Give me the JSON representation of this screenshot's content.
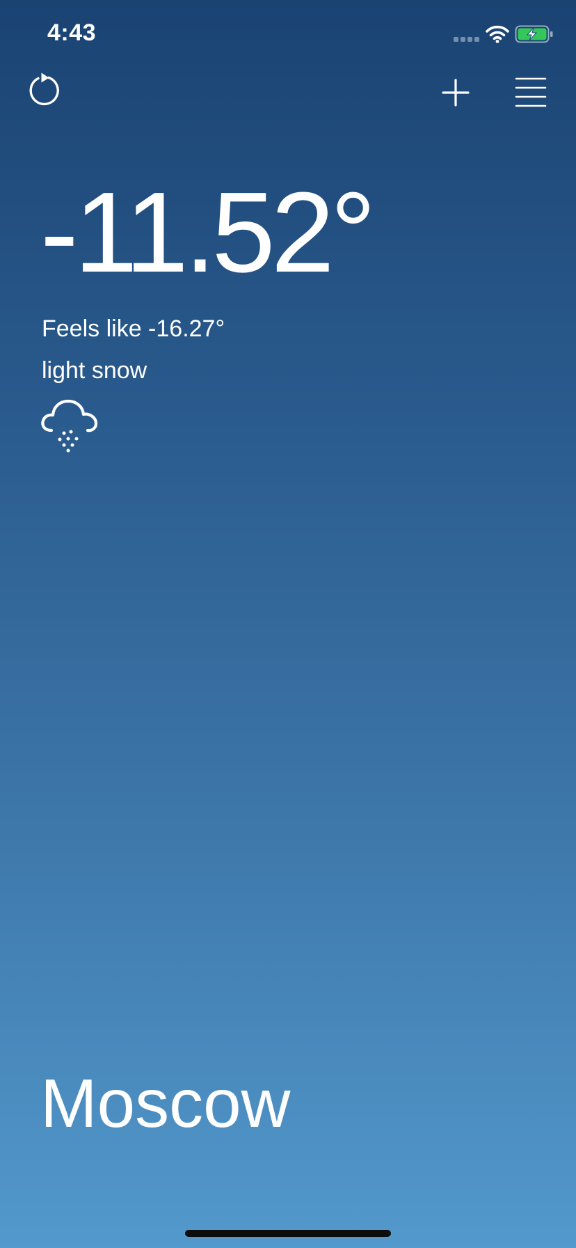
{
  "status_bar": {
    "time": "4:43",
    "signal_icon": "cellular-dots-icon",
    "wifi_icon": "wifi-icon",
    "battery_icon": "battery-charging-icon",
    "battery_color": "#34c759"
  },
  "toolbar": {
    "refresh_icon": "refresh-icon",
    "add_icon": "plus-icon",
    "menu_icon": "hamburger-menu-icon"
  },
  "weather": {
    "temperature": "-11.52°",
    "feels_like": "Feels like -16.27°",
    "description": "light snow",
    "condition_icon": "cloud-snow-icon"
  },
  "location": {
    "city": "Moscow"
  },
  "colors": {
    "gradient_top": "#1a4372",
    "gradient_bottom": "#5399cc",
    "text": "#ffffff"
  }
}
